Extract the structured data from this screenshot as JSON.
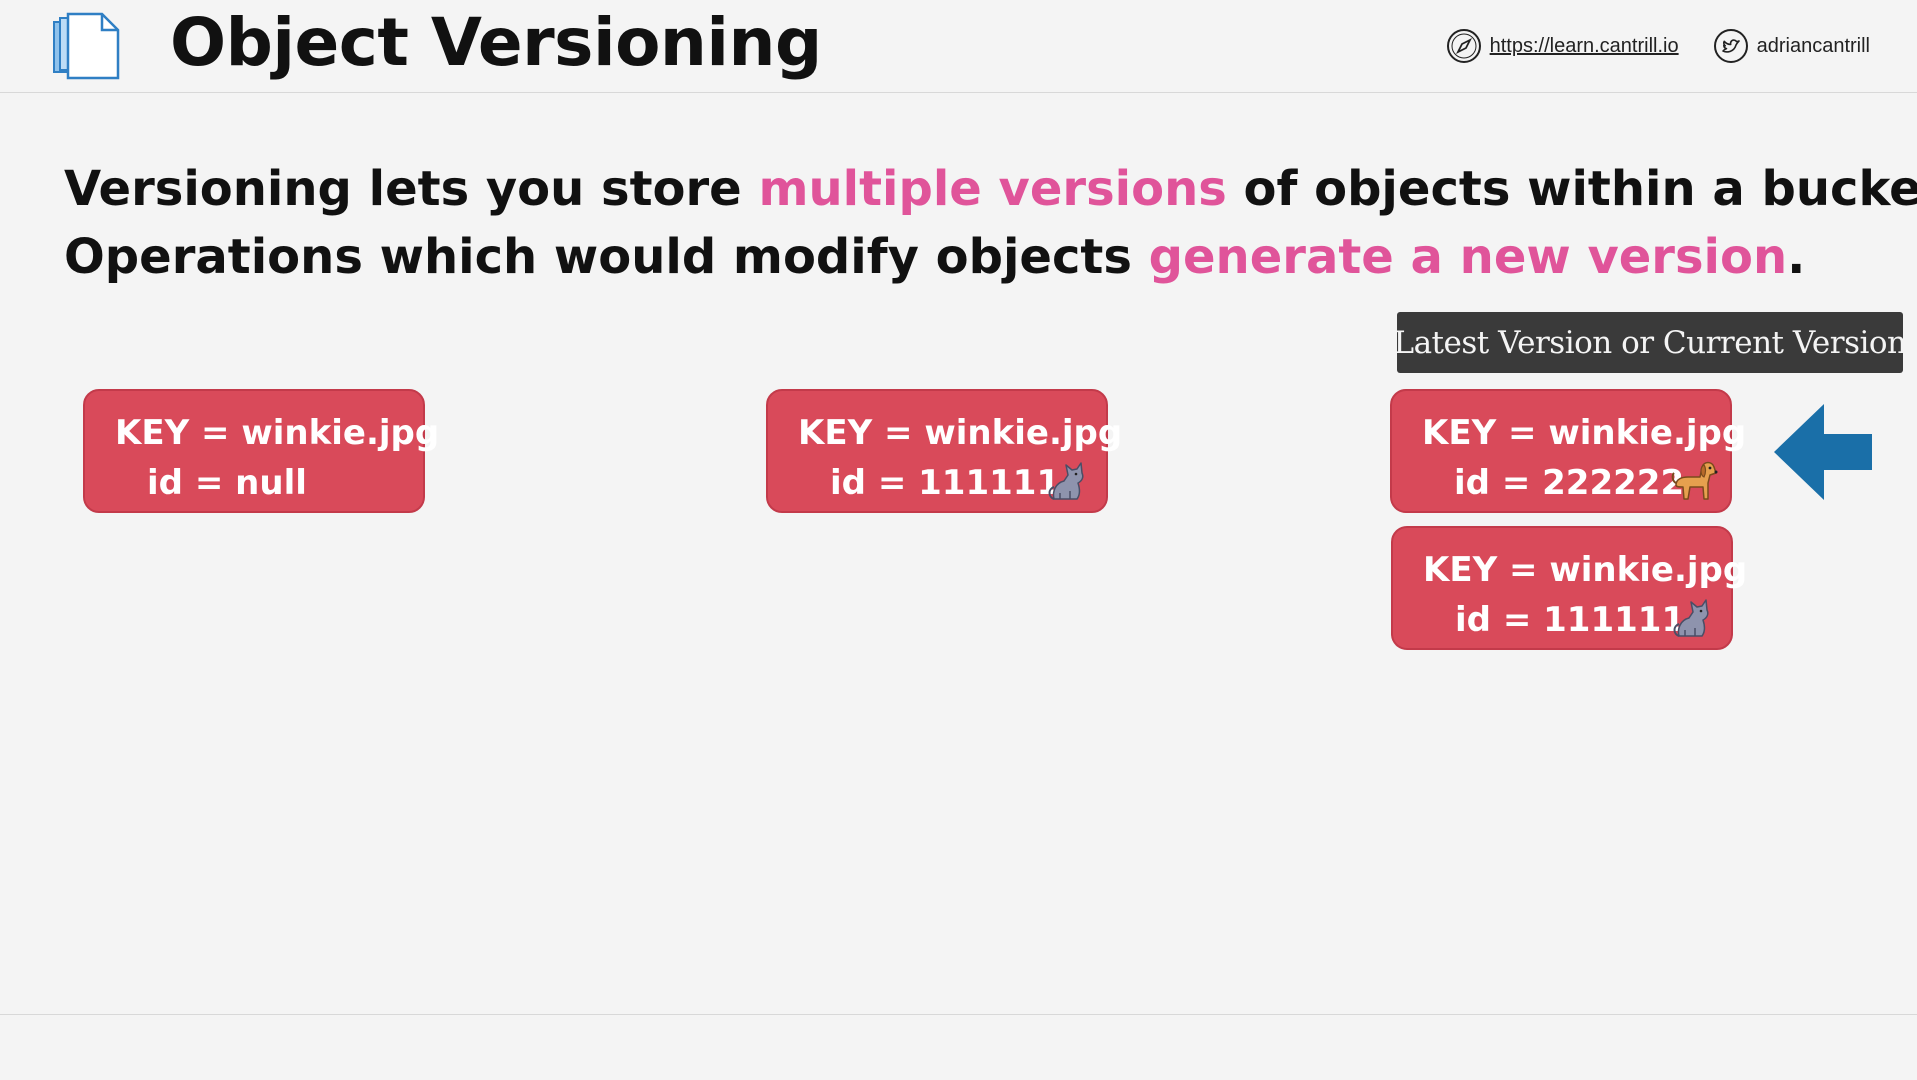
{
  "header": {
    "title": "Object Versioning",
    "title_icon": "document-stack-icon",
    "links": [
      {
        "icon": "compass-icon",
        "text": "https://learn.cantrill.io"
      },
      {
        "icon": "twitter-icon",
        "text": "adriancantrill"
      }
    ]
  },
  "statement": {
    "line1_a": "Versioning lets you store ",
    "line1_hl": "multiple versions",
    "line1_b": " of objects within a bucket.",
    "line2_a": "Operations which would modify objects ",
    "line2_hl": "generate a new version",
    "line2_b": "."
  },
  "tooltip": "Latest Version or Current Version",
  "objects": [
    {
      "key": "KEY = winkie.jpg",
      "id": "id = null",
      "icon": ""
    },
    {
      "key": "KEY = winkie.jpg",
      "id": "id = 111111",
      "icon": "cat-icon"
    },
    {
      "key": "KEY = winkie.jpg",
      "id": "id = 222222",
      "icon": "dog-icon"
    },
    {
      "key": "KEY = winkie.jpg",
      "id": "id = 111111",
      "icon": "cat-icon"
    }
  ],
  "colors": {
    "highlight": "#e0549a",
    "object_box": "#d94a5a",
    "arrow": "#1a6fa8",
    "tooltip_bg": "#3a3a3a"
  }
}
